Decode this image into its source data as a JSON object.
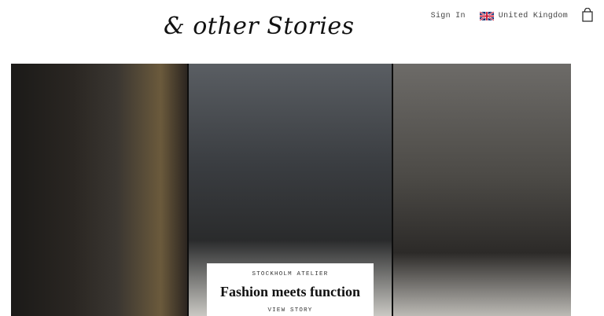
{
  "header": {
    "logo_text": "& other Stories",
    "sign_in_label": "Sign In",
    "country_label": "United Kingdom",
    "flag_icon": "uk-flag-icon",
    "bag_icon": "shopping-bag-icon"
  },
  "hero": {
    "eyebrow": "STOCKHOLM ATELIER",
    "headline": "Fashion meets function",
    "cta_label": "VIEW STORY"
  },
  "colors": {
    "background": "#ffffff",
    "text": "#111111",
    "dress_cream": "#ece7dc",
    "dress_brown": "#3b2418",
    "hair": "#9b4a24"
  }
}
